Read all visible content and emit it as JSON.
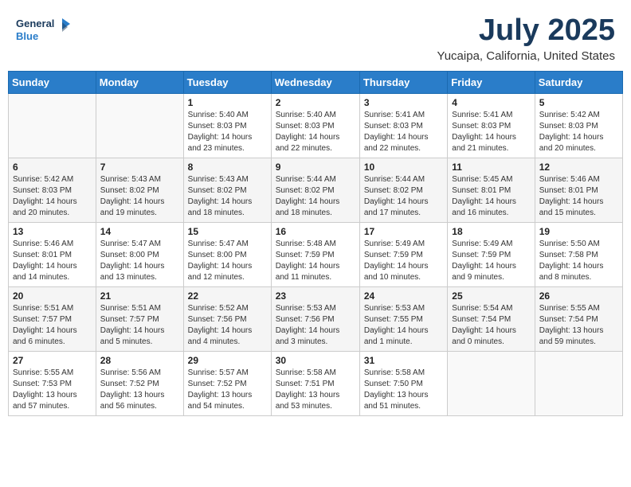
{
  "header": {
    "logo_line1": "General",
    "logo_line2": "Blue",
    "month": "July 2025",
    "location": "Yucaipa, California, United States"
  },
  "weekdays": [
    "Sunday",
    "Monday",
    "Tuesday",
    "Wednesday",
    "Thursday",
    "Friday",
    "Saturday"
  ],
  "weeks": [
    [
      {
        "day": "",
        "info": ""
      },
      {
        "day": "",
        "info": ""
      },
      {
        "day": "1",
        "info": "Sunrise: 5:40 AM\nSunset: 8:03 PM\nDaylight: 14 hours\nand 23 minutes."
      },
      {
        "day": "2",
        "info": "Sunrise: 5:40 AM\nSunset: 8:03 PM\nDaylight: 14 hours\nand 22 minutes."
      },
      {
        "day": "3",
        "info": "Sunrise: 5:41 AM\nSunset: 8:03 PM\nDaylight: 14 hours\nand 22 minutes."
      },
      {
        "day": "4",
        "info": "Sunrise: 5:41 AM\nSunset: 8:03 PM\nDaylight: 14 hours\nand 21 minutes."
      },
      {
        "day": "5",
        "info": "Sunrise: 5:42 AM\nSunset: 8:03 PM\nDaylight: 14 hours\nand 20 minutes."
      }
    ],
    [
      {
        "day": "6",
        "info": "Sunrise: 5:42 AM\nSunset: 8:03 PM\nDaylight: 14 hours\nand 20 minutes."
      },
      {
        "day": "7",
        "info": "Sunrise: 5:43 AM\nSunset: 8:02 PM\nDaylight: 14 hours\nand 19 minutes."
      },
      {
        "day": "8",
        "info": "Sunrise: 5:43 AM\nSunset: 8:02 PM\nDaylight: 14 hours\nand 18 minutes."
      },
      {
        "day": "9",
        "info": "Sunrise: 5:44 AM\nSunset: 8:02 PM\nDaylight: 14 hours\nand 18 minutes."
      },
      {
        "day": "10",
        "info": "Sunrise: 5:44 AM\nSunset: 8:02 PM\nDaylight: 14 hours\nand 17 minutes."
      },
      {
        "day": "11",
        "info": "Sunrise: 5:45 AM\nSunset: 8:01 PM\nDaylight: 14 hours\nand 16 minutes."
      },
      {
        "day": "12",
        "info": "Sunrise: 5:46 AM\nSunset: 8:01 PM\nDaylight: 14 hours\nand 15 minutes."
      }
    ],
    [
      {
        "day": "13",
        "info": "Sunrise: 5:46 AM\nSunset: 8:01 PM\nDaylight: 14 hours\nand 14 minutes."
      },
      {
        "day": "14",
        "info": "Sunrise: 5:47 AM\nSunset: 8:00 PM\nDaylight: 14 hours\nand 13 minutes."
      },
      {
        "day": "15",
        "info": "Sunrise: 5:47 AM\nSunset: 8:00 PM\nDaylight: 14 hours\nand 12 minutes."
      },
      {
        "day": "16",
        "info": "Sunrise: 5:48 AM\nSunset: 7:59 PM\nDaylight: 14 hours\nand 11 minutes."
      },
      {
        "day": "17",
        "info": "Sunrise: 5:49 AM\nSunset: 7:59 PM\nDaylight: 14 hours\nand 10 minutes."
      },
      {
        "day": "18",
        "info": "Sunrise: 5:49 AM\nSunset: 7:59 PM\nDaylight: 14 hours\nand 9 minutes."
      },
      {
        "day": "19",
        "info": "Sunrise: 5:50 AM\nSunset: 7:58 PM\nDaylight: 14 hours\nand 8 minutes."
      }
    ],
    [
      {
        "day": "20",
        "info": "Sunrise: 5:51 AM\nSunset: 7:57 PM\nDaylight: 14 hours\nand 6 minutes."
      },
      {
        "day": "21",
        "info": "Sunrise: 5:51 AM\nSunset: 7:57 PM\nDaylight: 14 hours\nand 5 minutes."
      },
      {
        "day": "22",
        "info": "Sunrise: 5:52 AM\nSunset: 7:56 PM\nDaylight: 14 hours\nand 4 minutes."
      },
      {
        "day": "23",
        "info": "Sunrise: 5:53 AM\nSunset: 7:56 PM\nDaylight: 14 hours\nand 3 minutes."
      },
      {
        "day": "24",
        "info": "Sunrise: 5:53 AM\nSunset: 7:55 PM\nDaylight: 14 hours\nand 1 minute."
      },
      {
        "day": "25",
        "info": "Sunrise: 5:54 AM\nSunset: 7:54 PM\nDaylight: 14 hours\nand 0 minutes."
      },
      {
        "day": "26",
        "info": "Sunrise: 5:55 AM\nSunset: 7:54 PM\nDaylight: 13 hours\nand 59 minutes."
      }
    ],
    [
      {
        "day": "27",
        "info": "Sunrise: 5:55 AM\nSunset: 7:53 PM\nDaylight: 13 hours\nand 57 minutes."
      },
      {
        "day": "28",
        "info": "Sunrise: 5:56 AM\nSunset: 7:52 PM\nDaylight: 13 hours\nand 56 minutes."
      },
      {
        "day": "29",
        "info": "Sunrise: 5:57 AM\nSunset: 7:52 PM\nDaylight: 13 hours\nand 54 minutes."
      },
      {
        "day": "30",
        "info": "Sunrise: 5:58 AM\nSunset: 7:51 PM\nDaylight: 13 hours\nand 53 minutes."
      },
      {
        "day": "31",
        "info": "Sunrise: 5:58 AM\nSunset: 7:50 PM\nDaylight: 13 hours\nand 51 minutes."
      },
      {
        "day": "",
        "info": ""
      },
      {
        "day": "",
        "info": ""
      }
    ]
  ]
}
